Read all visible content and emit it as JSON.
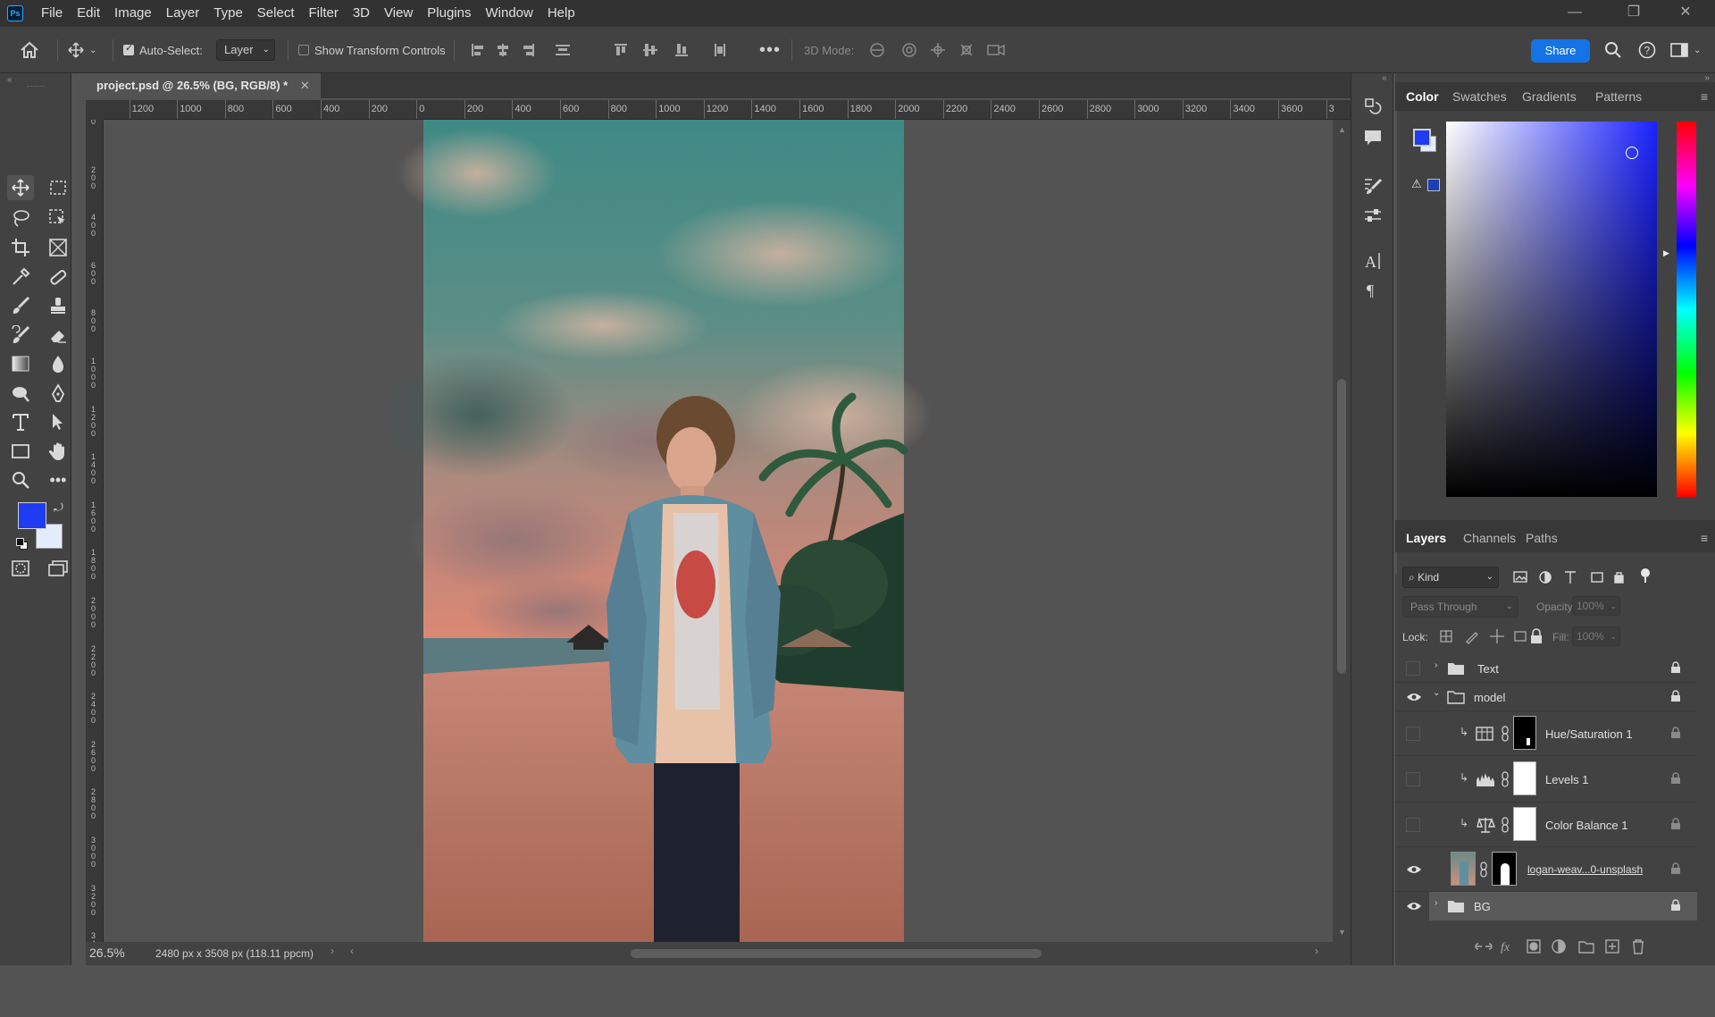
{
  "app": {
    "logo": "Ps"
  },
  "menu": [
    "File",
    "Edit",
    "Image",
    "Layer",
    "Type",
    "Select",
    "Filter",
    "3D",
    "View",
    "Plugins",
    "Window",
    "Help"
  ],
  "options": {
    "auto_select_label": "Auto-Select:",
    "auto_select_value": "Layer",
    "transform_label": "Show Transform Controls",
    "mode_3d_label": "3D Mode:",
    "share_label": "Share"
  },
  "document": {
    "tab_title": "project.psd @ 26.5% (BG, RGB/8) *",
    "ruler_top": [
      "00",
      "1200",
      "1000",
      "800",
      "600",
      "400",
      "200",
      "0",
      "200",
      "400",
      "600",
      "800",
      "1000",
      "1200",
      "1400",
      "1600",
      "1800",
      "2000",
      "2200",
      "2400",
      "2600",
      "2800",
      "3000",
      "3200",
      "3400",
      "3600",
      "3"
    ],
    "ruler_left": [
      "0",
      "2\n0\n0",
      "4\n0\n0",
      "6\n0\n0",
      "8\n0\n0",
      "1\n0\n0\n0",
      "1\n2\n0\n0",
      "1\n4\n0\n0",
      "1\n6\n0\n0",
      "1\n8\n0\n0",
      "2\n0\n0\n0",
      "2\n2\n0\n0",
      "2\n4\n0\n0",
      "2\n6\n0\n0",
      "2\n8\n0\n0",
      "3\n0\n0\n0",
      "3\n2\n0\n0",
      "3\n4\n0\n0"
    ]
  },
  "status": {
    "zoom": "26.5%",
    "doc_info": "2480 px x 3508 px (118.11 ppcm)"
  },
  "colors": {
    "foreground": "#1f3cf2",
    "background": "#e3ecfb",
    "accent": "#1473e6",
    "hue_selected": "#1a22ff"
  },
  "color_panel": {
    "tabs": [
      "Color",
      "Swatches",
      "Gradients",
      "Patterns"
    ],
    "active": "Color"
  },
  "layers_panel": {
    "tabs": [
      "Layers",
      "Channels",
      "Paths"
    ],
    "active": "Layers",
    "filter_kind": "Kind",
    "blend_mode": "Pass Through",
    "opacity_label": "Opacity:",
    "opacity_value": "100%",
    "lock_label": "Lock:",
    "fill_label": "Fill:",
    "fill_value": "100%",
    "layers": [
      {
        "name": "Text",
        "type": "group",
        "visible": false,
        "expanded": false
      },
      {
        "name": "model",
        "type": "group",
        "visible": true,
        "expanded": true
      },
      {
        "name": "Hue/Saturation 1",
        "type": "adjustment",
        "visible": false,
        "icon": "hue-saturation-icon"
      },
      {
        "name": "Levels 1",
        "type": "adjustment",
        "visible": false,
        "icon": "levels-icon"
      },
      {
        "name": "Color Balance 1",
        "type": "adjustment",
        "visible": false,
        "icon": "color-balance-icon"
      },
      {
        "name": "logan-weav...0-unsplash",
        "type": "image",
        "visible": true
      },
      {
        "name": "BG",
        "type": "group",
        "visible": true,
        "expanded": false,
        "selected": true
      }
    ]
  }
}
